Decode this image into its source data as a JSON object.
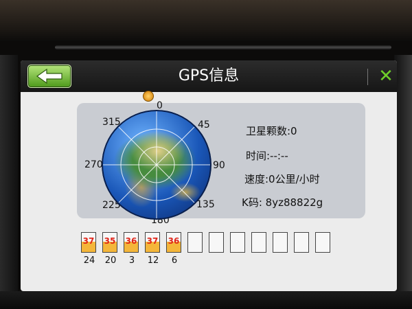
{
  "header": {
    "title": "GPS信息"
  },
  "compass": {
    "n": "0",
    "ne": "45",
    "e": "90",
    "se": "135",
    "s": "180",
    "sw": "225",
    "w": "270",
    "nw": "315"
  },
  "info": {
    "satellite_count": "卫星颗数:0",
    "time": "时间:--:--",
    "speed": "速度:0公里/小时",
    "k_code": "K码: 8yz88822g"
  },
  "satellites": [
    {
      "value": "37",
      "id": "24",
      "level": 0.55
    },
    {
      "value": "35",
      "id": "20",
      "level": 0.52
    },
    {
      "value": "36",
      "id": "3",
      "level": 0.53
    },
    {
      "value": "37",
      "id": "12",
      "level": 0.55
    },
    {
      "value": "36",
      "id": "6",
      "level": 0.53
    },
    {
      "value": "",
      "id": "",
      "level": 0
    },
    {
      "value": "",
      "id": "",
      "level": 0
    },
    {
      "value": "",
      "id": "",
      "level": 0
    },
    {
      "value": "",
      "id": "",
      "level": 0
    },
    {
      "value": "",
      "id": "",
      "level": 0
    },
    {
      "value": "",
      "id": "",
      "level": 0
    },
    {
      "value": "",
      "id": "",
      "level": 0
    }
  ],
  "icons": {
    "back": "back-arrow-icon",
    "close": "close-icon",
    "globe": "globe-icon",
    "sun": "sun-icon"
  },
  "colors": {
    "accent_green": "#6fcf2a",
    "signal_bar": "#f4b63a",
    "signal_text": "#e0261b"
  }
}
